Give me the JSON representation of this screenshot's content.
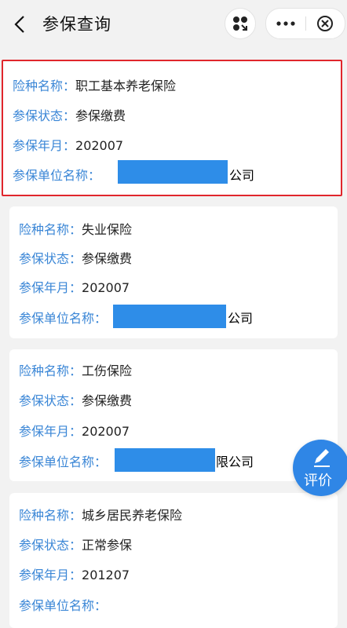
{
  "header": {
    "title": "参保查询",
    "icons": {
      "back": "chevron-left-icon",
      "apps": "grid-dots-icon",
      "more": "ellipsis-icon",
      "close": "close-circle-icon"
    }
  },
  "labels": {
    "type": "险种名称：",
    "status": "参保状态：",
    "month": "参保年月：",
    "employer": "参保单位名称："
  },
  "cards": [
    {
      "type": "职工基本养老保险",
      "status": "参保缴费",
      "month": "202007",
      "employer_prefix": "",
      "employer_suffix": "公司"
    },
    {
      "type": "失业保险",
      "status": "参保缴费",
      "month": "202007",
      "employer_prefix": "",
      "employer_suffix": "公司"
    },
    {
      "type": "工伤保险",
      "status": "参保缴费",
      "month": "202007",
      "employer_prefix": "",
      "employer_suffix": "限公司"
    },
    {
      "type": "城乡居民养老保险",
      "status": "正常参保",
      "month": "201207",
      "employer_prefix": "",
      "employer_suffix": ""
    }
  ],
  "fab": {
    "label": "评价",
    "icon": "pencil-icon"
  },
  "colors": {
    "label": "#3a86d6",
    "highlight": "#e0262c",
    "mask": "#2e8de8",
    "fab": "#2f86e6"
  }
}
